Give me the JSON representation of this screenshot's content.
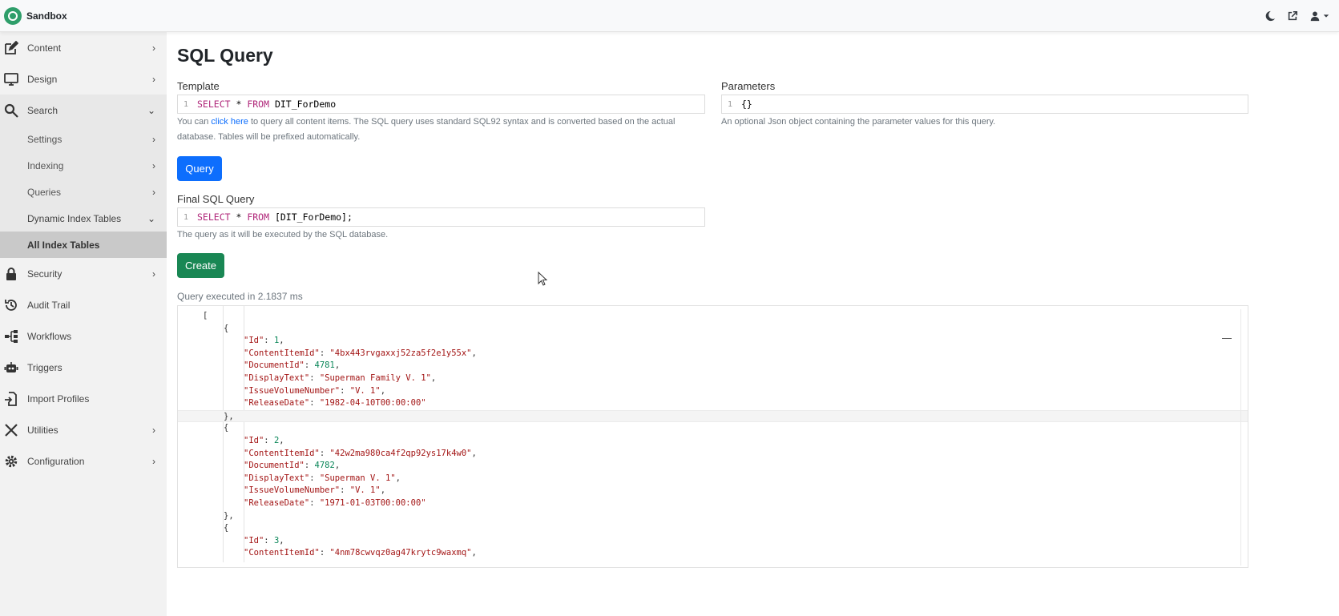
{
  "app": {
    "brand": "Sandbox"
  },
  "topbar": {
    "icons": [
      "moon-icon",
      "external-link-icon",
      "user-icon"
    ]
  },
  "sidebar": {
    "items": [
      {
        "label": "Content",
        "icon": "edit-icon"
      },
      {
        "label": "Design",
        "icon": "monitor-icon"
      },
      {
        "label": "Search",
        "icon": "search-icon"
      },
      {
        "label": "Settings"
      },
      {
        "label": "Indexing"
      },
      {
        "label": "Queries"
      },
      {
        "label": "Dynamic Index Tables"
      },
      {
        "label": "All Index Tables"
      },
      {
        "label": "Security",
        "icon": "lock-icon"
      },
      {
        "label": "Audit Trail",
        "icon": "history-icon"
      },
      {
        "label": "Workflows",
        "icon": "workflow-icon"
      },
      {
        "label": "Triggers",
        "icon": "robot-icon"
      },
      {
        "label": "Import Profiles",
        "icon": "import-icon"
      },
      {
        "label": "Utilities",
        "icon": "tools-icon"
      },
      {
        "label": "Configuration",
        "icon": "gear-icon"
      }
    ]
  },
  "main": {
    "title": "SQL Query",
    "template": {
      "label": "Template",
      "line_number": "1",
      "code_keyword_1": "SELECT",
      "code_mid": " * ",
      "code_keyword_2": "FROM",
      "code_rest": " DIT_ForDemo",
      "help_prefix": "You can ",
      "help_link": "click here",
      "help_suffix": " to query all content items. The SQL query uses standard SQL92 syntax and is converted based on the actual database. Tables will be prefixed automatically."
    },
    "parameters": {
      "label": "Parameters",
      "line_number": "1",
      "value": "{}",
      "help": "An optional Json object containing the parameter values for this query."
    },
    "query_button": "Query",
    "final_sql": {
      "label": "Final SQL Query",
      "line_number": "1",
      "code_keyword_1": "SELECT",
      "code_mid": " * ",
      "code_keyword_2": "FROM",
      "code_rest": " [DIT_ForDemo];",
      "help": "The query as it will be executed by the SQL database."
    },
    "create_button": "Create",
    "exec_time": "Query executed in 2.1837 ms",
    "results": [
      {
        "Id": "1",
        "ContentItemId": "\"4bx443rvgaxxj52za5f2e1y55x\"",
        "DocumentId": "4781",
        "DisplayText": "\"Superman Family V. 1\"",
        "IssueVolumeNumber": "\"V. 1\"",
        "ReleaseDate": "\"1982-04-10T00:00:00\""
      },
      {
        "Id": "2",
        "ContentItemId": "\"42w2ma980ca4f2qp92ys17k4w0\"",
        "DocumentId": "4782",
        "DisplayText": "\"Superman V. 1\"",
        "IssueVolumeNumber": "\"V. 1\"",
        "ReleaseDate": "\"1971-01-03T00:00:00\""
      },
      {
        "Id": "3",
        "ContentItemId": "\"4nm78cwvqz0ag47krytc9waxmq\""
      }
    ],
    "json_keys": {
      "Id": "\"Id\"",
      "ContentItemId": "\"ContentItemId\"",
      "DocumentId": "\"DocumentId\"",
      "DisplayText": "\"DisplayText\"",
      "IssueVolumeNumber": "\"IssueVolumeNumber\"",
      "ReleaseDate": "\"ReleaseDate\""
    }
  }
}
